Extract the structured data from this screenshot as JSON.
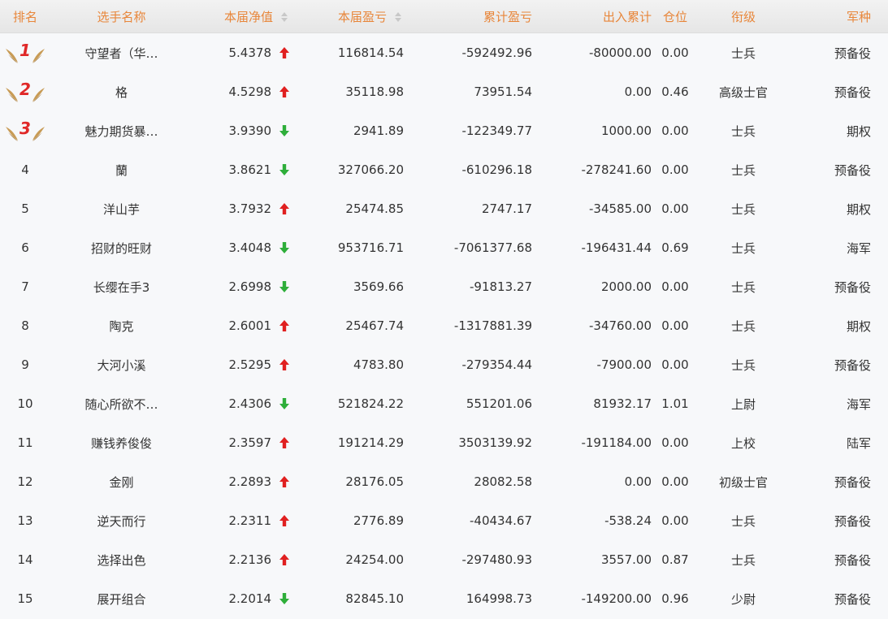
{
  "colors": {
    "header_text": "#e8863a",
    "up": "#e02020",
    "down": "#2eae3a",
    "medal_num": "#e02828",
    "wing": "#c89b55"
  },
  "headers": {
    "rank": "排名",
    "name": "选手名称",
    "nav": "本届净值",
    "cur_pnl": "本届盈亏",
    "cum_pnl": "累计盈亏",
    "io": "出入累计",
    "pos": "仓位",
    "grade": "衔级",
    "type": "军种"
  },
  "rows": [
    {
      "rank": "1",
      "medal": true,
      "name": "守望者（华…",
      "nav": "5.4378",
      "dir": "up",
      "cur": "116814.54",
      "cum": "-592492.96",
      "io": "-80000.00",
      "pos": "0.00",
      "grade": "士兵",
      "type": "预备役"
    },
    {
      "rank": "2",
      "medal": true,
      "name": "格",
      "nav": "4.5298",
      "dir": "up",
      "cur": "35118.98",
      "cum": "73951.54",
      "io": "0.00",
      "pos": "0.46",
      "grade": "高级士官",
      "type": "预备役"
    },
    {
      "rank": "3",
      "medal": true,
      "name": "魅力期货暴…",
      "nav": "3.9390",
      "dir": "down",
      "cur": "2941.89",
      "cum": "-122349.77",
      "io": "1000.00",
      "pos": "0.00",
      "grade": "士兵",
      "type": "期权"
    },
    {
      "rank": "4",
      "medal": false,
      "name": "蘭",
      "nav": "3.8621",
      "dir": "down",
      "cur": "327066.20",
      "cum": "-610296.18",
      "io": "-278241.60",
      "pos": "0.00",
      "grade": "士兵",
      "type": "预备役"
    },
    {
      "rank": "5",
      "medal": false,
      "name": "洋山芋",
      "nav": "3.7932",
      "dir": "up",
      "cur": "25474.85",
      "cum": "2747.17",
      "io": "-34585.00",
      "pos": "0.00",
      "grade": "士兵",
      "type": "期权"
    },
    {
      "rank": "6",
      "medal": false,
      "name": "招财的旺财",
      "nav": "3.4048",
      "dir": "down",
      "cur": "953716.71",
      "cum": "-7061377.68",
      "io": "-196431.44",
      "pos": "0.69",
      "grade": "士兵",
      "type": "海军"
    },
    {
      "rank": "7",
      "medal": false,
      "name": "长缨在手3",
      "nav": "2.6998",
      "dir": "down",
      "cur": "3569.66",
      "cum": "-91813.27",
      "io": "2000.00",
      "pos": "0.00",
      "grade": "士兵",
      "type": "预备役"
    },
    {
      "rank": "8",
      "medal": false,
      "name": "陶克",
      "nav": "2.6001",
      "dir": "up",
      "cur": "25467.74",
      "cum": "-1317881.39",
      "io": "-34760.00",
      "pos": "0.00",
      "grade": "士兵",
      "type": "期权"
    },
    {
      "rank": "9",
      "medal": false,
      "name": "大河小溪",
      "nav": "2.5295",
      "dir": "up",
      "cur": "4783.80",
      "cum": "-279354.44",
      "io": "-7900.00",
      "pos": "0.00",
      "grade": "士兵",
      "type": "预备役"
    },
    {
      "rank": "10",
      "medal": false,
      "name": "随心所欲不…",
      "nav": "2.4306",
      "dir": "down",
      "cur": "521824.22",
      "cum": "551201.06",
      "io": "81932.17",
      "pos": "1.01",
      "grade": "上尉",
      "type": "海军"
    },
    {
      "rank": "11",
      "medal": false,
      "name": "赚钱养俊俊",
      "nav": "2.3597",
      "dir": "up",
      "cur": "191214.29",
      "cum": "3503139.92",
      "io": "-191184.00",
      "pos": "0.00",
      "grade": "上校",
      "type": "陆军"
    },
    {
      "rank": "12",
      "medal": false,
      "name": "金刚",
      "nav": "2.2893",
      "dir": "up",
      "cur": "28176.05",
      "cum": "28082.58",
      "io": "0.00",
      "pos": "0.00",
      "grade": "初级士官",
      "type": "预备役"
    },
    {
      "rank": "13",
      "medal": false,
      "name": "逆天而行",
      "nav": "2.2311",
      "dir": "up",
      "cur": "2776.89",
      "cum": "-40434.67",
      "io": "-538.24",
      "pos": "0.00",
      "grade": "士兵",
      "type": "预备役"
    },
    {
      "rank": "14",
      "medal": false,
      "name": "选择出色",
      "nav": "2.2136",
      "dir": "up",
      "cur": "24254.00",
      "cum": "-297480.93",
      "io": "3557.00",
      "pos": "0.87",
      "grade": "士兵",
      "type": "预备役"
    },
    {
      "rank": "15",
      "medal": false,
      "name": "展开组合",
      "nav": "2.2014",
      "dir": "down",
      "cur": "82845.10",
      "cum": "164998.73",
      "io": "-149200.00",
      "pos": "0.96",
      "grade": "少尉",
      "type": "预备役"
    }
  ]
}
